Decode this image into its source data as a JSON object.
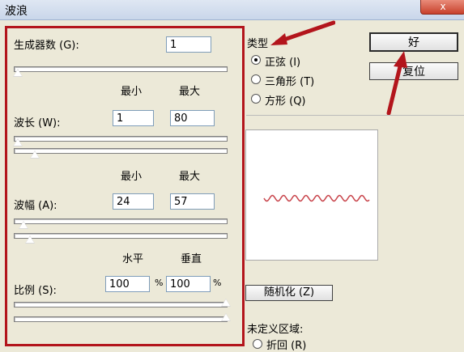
{
  "window": {
    "title": "波浪",
    "close_label": "x"
  },
  "panel": {
    "generators": {
      "label": "生成器数 (G):",
      "value": "1"
    },
    "min_label": "最小",
    "max_label": "最大",
    "wavelength": {
      "label": "波长 (W):",
      "min": "1",
      "max": "80"
    },
    "amplitude": {
      "label": "波幅 (A):",
      "min": "24",
      "max": "57"
    },
    "horizontal_label": "水平",
    "vertical_label": "垂直",
    "scale": {
      "label": "比例 (S):",
      "horizontal": "100",
      "vertical": "100",
      "unit": "%"
    }
  },
  "type_group": {
    "title": "类型",
    "options": [
      {
        "label": "正弦 (I)",
        "selected": true
      },
      {
        "label": "三角形 (T)",
        "selected": false
      },
      {
        "label": "方形 (Q)",
        "selected": false
      }
    ]
  },
  "buttons": {
    "ok": "好",
    "reset": "复位",
    "randomize": "随机化 (Z)"
  },
  "undefined_area": {
    "title": "未定义区域:",
    "option": "折回 (R)"
  },
  "colors": {
    "highlight": "#b3151c",
    "wave": "#c8434a"
  }
}
